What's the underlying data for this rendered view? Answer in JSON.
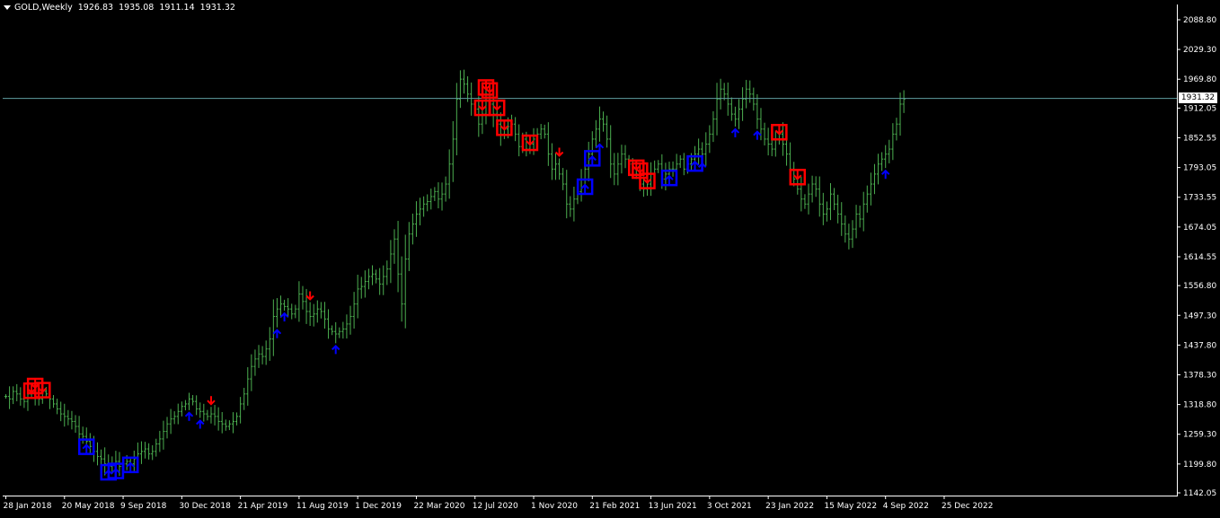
{
  "header": {
    "symbol": "GOLD,Weekly",
    "open": "1926.83",
    "high": "1935.08",
    "low": "1911.14",
    "close": "1931.32"
  },
  "current_price_label": "1931.32",
  "colors": {
    "background": "#000000",
    "bars": "#4caf50",
    "axis": "#ffffff",
    "price_line": "#5f9ea0",
    "sell_marker": "#ff0000",
    "buy_marker": "#0000ff",
    "box_edge_alt": "#ff8c00"
  },
  "chart_data": {
    "type": "ohlc",
    "title": "GOLD,Weekly",
    "ylim": [
      1142.05,
      2088.8
    ],
    "current_price": 1931.32,
    "y_ticks": [
      "2088.80",
      "2029.30",
      "1969.80",
      "1912.05",
      "1852.55",
      "1793.05",
      "1733.55",
      "1674.05",
      "1614.55",
      "1556.80",
      "1497.30",
      "1437.80",
      "1378.30",
      "1318.80",
      "1259.30",
      "1199.80",
      "1142.05"
    ],
    "x_ticks": [
      "28 Jan 2018",
      "20 May 2018",
      "9 Sep 2018",
      "30 Dec 2018",
      "21 Apr 2019",
      "11 Aug 2019",
      "1 Dec 2019",
      "22 Mar 2020",
      "12 Jul 2020",
      "1 Nov 2020",
      "21 Feb 2021",
      "13 Jun 2021",
      "3 Oct 2021",
      "23 Jan 2022",
      "15 May 2022",
      "4 Sep 2022",
      "25 Dec 2022"
    ],
    "x_tick_index": [
      0,
      16,
      32,
      48,
      64,
      80,
      96,
      112,
      128,
      144,
      160,
      176,
      192,
      208,
      224,
      240,
      256
    ],
    "series": [
      {
        "values": [
          1335,
          1330,
          1345,
          1340,
          1330,
          1325,
          1340,
          1345,
          1335,
          1330,
          1345,
          1340,
          1330,
          1320,
          1310,
          1300,
          1295,
          1290,
          1285,
          1275,
          1260,
          1255,
          1245,
          1235,
          1225,
          1215,
          1210,
          1200,
          1195,
          1200,
          1205,
          1195,
          1200,
          1205,
          1200,
          1210,
          1220,
          1225,
          1230,
          1220,
          1225,
          1240,
          1250,
          1265,
          1280,
          1290,
          1295,
          1305,
          1315,
          1320,
          1330,
          1325,
          1310,
          1305,
          1300,
          1295,
          1300,
          1295,
          1285,
          1280,
          1275,
          1280,
          1285,
          1295,
          1320,
          1340,
          1370,
          1395,
          1410,
          1420,
          1415,
          1430,
          1450,
          1495,
          1510,
          1520,
          1515,
          1510,
          1500,
          1510,
          1540,
          1525,
          1505,
          1495,
          1500,
          1510,
          1505,
          1490,
          1470,
          1465,
          1460,
          1465,
          1470,
          1480,
          1495,
          1520,
          1550,
          1555,
          1565,
          1575,
          1580,
          1570,
          1560,
          1575,
          1590,
          1620,
          1650,
          1580,
          1520,
          1610,
          1660,
          1680,
          1700,
          1710,
          1720,
          1725,
          1735,
          1745,
          1730,
          1740,
          1760,
          1800,
          1850,
          1930,
          1970,
          1960,
          1940,
          1920,
          1910,
          1880,
          1900,
          1940,
          1920,
          1900,
          1880,
          1860,
          1870,
          1875,
          1880,
          1860,
          1835,
          1850,
          1830,
          1840,
          1850,
          1860,
          1870,
          1860,
          1820,
          1790,
          1800,
          1780,
          1760,
          1720,
          1710,
          1730,
          1745,
          1770,
          1790,
          1820,
          1850,
          1870,
          1890,
          1880,
          1850,
          1800,
          1780,
          1800,
          1820,
          1810,
          1800,
          1790,
          1780,
          1760,
          1750,
          1760,
          1780,
          1790,
          1800,
          1770,
          1780,
          1790,
          1790,
          1800,
          1810,
          1790,
          1800,
          1810,
          1820,
          1830,
          1820,
          1840,
          1860,
          1890,
          1930,
          1950,
          1940,
          1920,
          1900,
          1890,
          1910,
          1930,
          1950,
          1940,
          1920,
          1890,
          1870,
          1850,
          1840,
          1830,
          1850,
          1860,
          1840,
          1820,
          1790,
          1770,
          1750,
          1730,
          1720,
          1740,
          1760,
          1750,
          1720,
          1700,
          1710,
          1740,
          1720,
          1700,
          1680,
          1660,
          1650,
          1670,
          1700,
          1690,
          1720,
          1740,
          1760,
          1780,
          1800,
          1810,
          1820,
          1830,
          1860,
          1880,
          1920,
          1930
        ],
        "markers_sell": [
          [
            7,
            "box"
          ],
          [
            8,
            "box"
          ],
          [
            10,
            "box"
          ],
          [
            56,
            "arrow"
          ],
          [
            83,
            "arrow"
          ],
          [
            130,
            "box"
          ],
          [
            131,
            "box"
          ],
          [
            132,
            "box"
          ],
          [
            134,
            "box"
          ],
          [
            136,
            "box"
          ],
          [
            143,
            "box"
          ],
          [
            151,
            "arrow"
          ],
          [
            172,
            "box"
          ],
          [
            173,
            "box"
          ],
          [
            175,
            "box"
          ],
          [
            211,
            "box"
          ],
          [
            216,
            "box"
          ]
        ],
        "markers_buy": [
          [
            22,
            "box"
          ],
          [
            28,
            "box"
          ],
          [
            30,
            "box"
          ],
          [
            34,
            "box"
          ],
          [
            50,
            "arrow"
          ],
          [
            53,
            "arrow"
          ],
          [
            74,
            "arrow"
          ],
          [
            76,
            "arrow"
          ],
          [
            90,
            "arrow"
          ],
          [
            158,
            "box"
          ],
          [
            160,
            "box"
          ],
          [
            162,
            "arrow"
          ],
          [
            181,
            "box"
          ],
          [
            188,
            "box"
          ],
          [
            190,
            "arrow"
          ],
          [
            199,
            "arrow"
          ],
          [
            205,
            "arrow"
          ],
          [
            240,
            "arrow"
          ]
        ]
      }
    ]
  }
}
